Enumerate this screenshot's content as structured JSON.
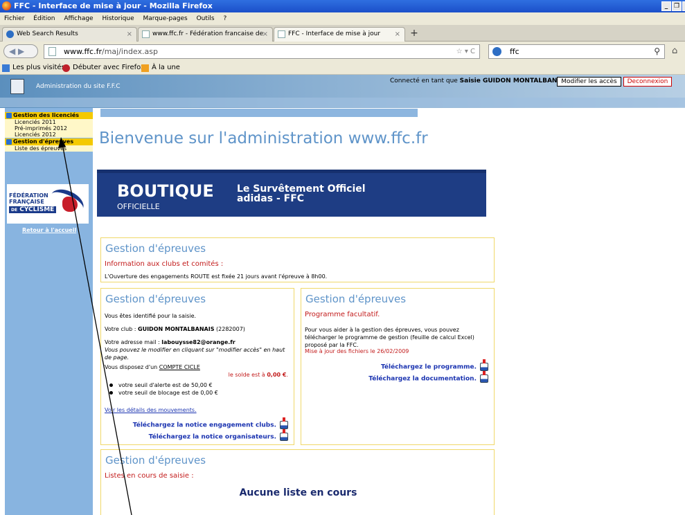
{
  "window": {
    "title": "FFC - Interface de mise à jour - Mozilla Firefox",
    "controls": [
      "_",
      "❐",
      "x"
    ]
  },
  "menu": [
    "Fichier",
    "Édition",
    "Affichage",
    "Historique",
    "Marque-pages",
    "Outils",
    "?"
  ],
  "tabs": [
    {
      "label": "Web Search Results",
      "active": false
    },
    {
      "label": "www.ffc.fr - Fédération francaise de cycl...",
      "active": false
    },
    {
      "label": "FFC - Interface de mise à jour",
      "active": true
    }
  ],
  "nav": {
    "url_host": "www.ffc.fr",
    "url_path": "/maj/index.asp",
    "url_buttons": "☆ ▾ C",
    "search_value": "ffc"
  },
  "bookmarks": [
    "Les plus visités",
    "Débuter avec Firefox",
    "À la une"
  ],
  "site": {
    "admin_title": "Administration du site F.F.C",
    "connected_prefix": "Connecté en tant que ",
    "connected_user": "Saisie GUIDON MONTALBANAIS",
    "modify_access": "Modifier les accès",
    "logout": "Deconnexion"
  },
  "sidebar": {
    "section1": "Gestion des licenciés",
    "items1": [
      "Licenciés 2011",
      "Pré-imprimés 2012",
      "Licenciés 2012"
    ],
    "section2": "Gestion d'épreuves",
    "items2": [
      "Liste des épreuves"
    ],
    "logo_line1": "FÉDÉRATION",
    "logo_line2": "FRANÇAISE",
    "logo_line3": "CYCLISME",
    "logo_de": "DE",
    "back_home": "Retour à l'accueil"
  },
  "main": {
    "welcome": "Bienvenue sur l'administration www.ffc.fr",
    "banner": {
      "big": "BOUTIQUE",
      "sub": "OFFICIELLE",
      "right1": "Le Survêtement Officiel",
      "right2": "adidas - FFC"
    },
    "panel_title": "Gestion d'épreuves",
    "p1": {
      "info": "Information aux clubs et comités :",
      "text": "L'Ouverture des engagements ROUTE est fixée 21 jours avant l'épreuve à 8h00."
    },
    "p2": {
      "identified": "Vous êtes identifié pour la saisie.",
      "club_prefix": "Votre club : ",
      "club": "GUIDON MONTALBANAIS",
      "club_num": " (2282007)",
      "mail_prefix": "Votre adresse mail : ",
      "mail": "labouysse82@orange.fr",
      "mail_note": "Vous pouvez le modifier en cliquant sur \"modifier accès\" en haut de page.",
      "compte_prefix": "Vous disposez d'un ",
      "compte": "COMPTE CICLE",
      "solde_prefix": "le solde est à ",
      "solde": "0,00 €",
      "seuil1": "votre seuil d'alerte est de 50,00 €",
      "seuil2": "votre seuil de blocage est de 0,00 €",
      "details": "Voir les détails des mouvements.",
      "dl1": "Téléchargez la notice engagement clubs.",
      "dl2": "Téléchargez la notice organisateurs."
    },
    "p3": {
      "subtitle": "Programme facultatif.",
      "text": "Pour vous aider à la gestion des épreuves, vous pouvez télécharger le programme de gestion (feuille de calcul Excel) proposé par la FFC.",
      "update": "Mise à jour des fichiers le 26/02/2009",
      "dl1": "Téléchargez le programme.",
      "dl2": "Téléchargez la documentation."
    },
    "p4": {
      "subtitle": "Listes en cours de saisie :",
      "none": "Aucune liste en cours"
    }
  }
}
